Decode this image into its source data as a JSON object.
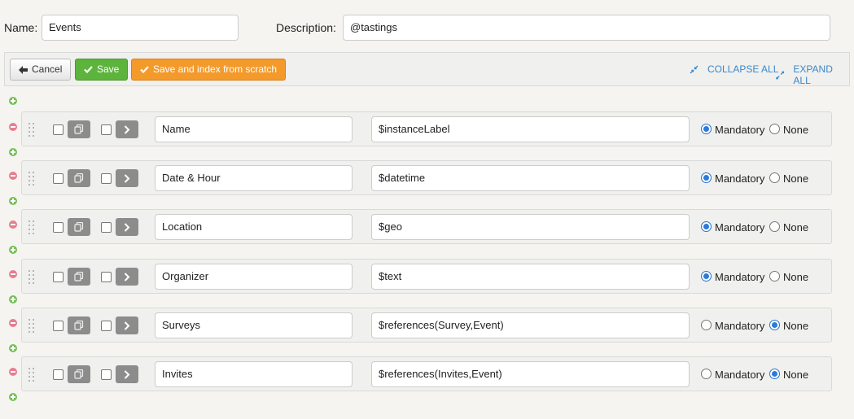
{
  "form": {
    "name_label": "Name:",
    "name_value": "Events",
    "description_label": "Description:",
    "description_value": "@tastings"
  },
  "toolbar": {
    "cancel_label": "Cancel",
    "save_label": "Save",
    "save_index_label": "Save and index from scratch",
    "collapse_all_label": "COLLAPSE ALL",
    "expand_all_label": "EXPAND ALL"
  },
  "colors": {
    "save": "#5cb43c",
    "save_index": "#f39a2b",
    "link": "#3a88c8",
    "radio_selected": "#2a7bdc",
    "add": "#77bf5a",
    "remove": "#e77d8f"
  },
  "radio_labels": {
    "mandatory": "Mandatory",
    "none": "None"
  },
  "fields": [
    {
      "name": "Name",
      "type": "$instanceLabel",
      "requirement": "Mandatory"
    },
    {
      "name": "Date & Hour",
      "type": "$datetime",
      "requirement": "Mandatory"
    },
    {
      "name": "Location",
      "type": "$geo",
      "requirement": "Mandatory"
    },
    {
      "name": "Organizer",
      "type": "$text",
      "requirement": "Mandatory"
    },
    {
      "name": "Surveys",
      "type": "$references(Survey,Event)",
      "requirement": "None"
    },
    {
      "name": "Invites",
      "type": "$references(Invites,Event)",
      "requirement": "None"
    }
  ]
}
